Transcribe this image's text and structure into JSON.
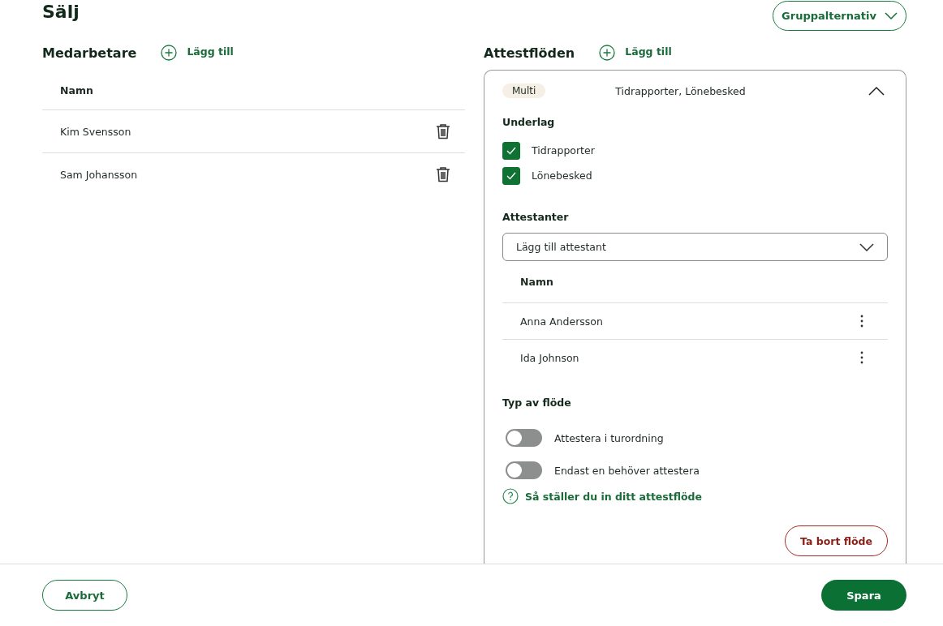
{
  "title": "Sälj",
  "group_options_button": "Gruppalternativ",
  "employees": {
    "heading": "Medarbetare",
    "add_label": "Lägg till",
    "column": "Namn",
    "rows": [
      {
        "name": "Kim Svensson"
      },
      {
        "name": "Sam Johansson"
      }
    ]
  },
  "flows": {
    "heading": "Attestflöden",
    "add_label": "Lägg till",
    "card": {
      "badge": "Multi",
      "summary": "Tidrapporter, Lönebesked",
      "expanded": true,
      "basis_heading": "Underlag",
      "basis": [
        {
          "label": "Tidrapporter",
          "checked": true
        },
        {
          "label": "Lönebesked",
          "checked": true
        }
      ],
      "approvers_heading": "Attestanter",
      "approver_select": "Lägg till attestant",
      "column": "Namn",
      "approvers": [
        {
          "name": "Anna Andersson"
        },
        {
          "name": "Ida Johnson"
        }
      ],
      "type_heading": "Typ av flöde",
      "types": [
        {
          "label": "Attestera i turordning",
          "on": false
        },
        {
          "label": "Endast en behöver attestera",
          "on": false
        }
      ],
      "help_link": "Så ställer du in ditt attestflöde",
      "delete_button": "Ta bort flöde"
    }
  },
  "footer": {
    "cancel": "Avbryt",
    "save": "Spara"
  }
}
